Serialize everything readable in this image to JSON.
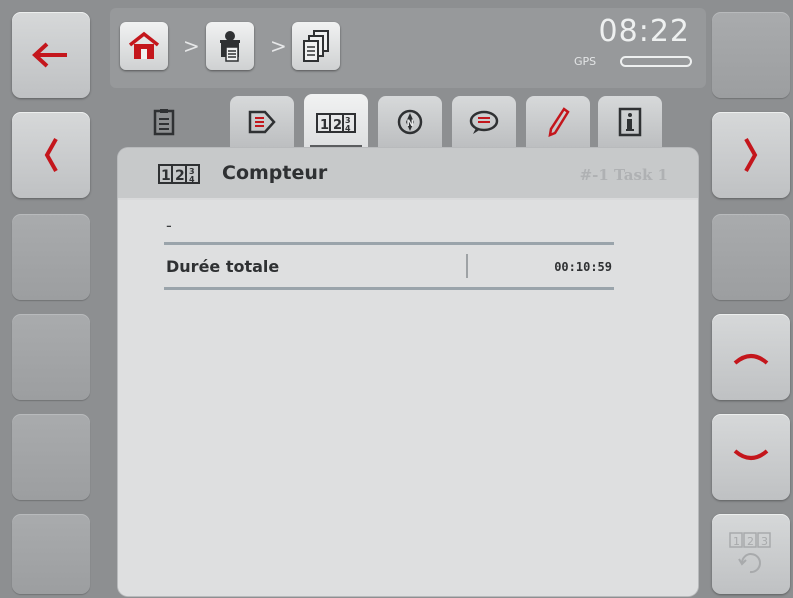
{
  "breadcrumb": {
    "separator": ">",
    "items": [
      "home-icon",
      "operator-icon",
      "task-list-icon"
    ]
  },
  "status": {
    "time": "08:22",
    "gps_label": "GPS"
  },
  "tabs": [
    {
      "icon": "document-icon",
      "active": false
    },
    {
      "icon": "export-icon",
      "active": false
    },
    {
      "icon": "counter-icon",
      "active": true
    },
    {
      "icon": "compass-icon",
      "active": false
    },
    {
      "icon": "comment-icon",
      "active": false
    },
    {
      "icon": "pencil-icon",
      "active": false
    },
    {
      "icon": "info-icon",
      "active": false
    }
  ],
  "panel": {
    "title": "Compteur",
    "task_label": "#-1 Task 1",
    "placeholder": "-",
    "rows": [
      {
        "label": "Durée totale",
        "value": "00:10:59"
      }
    ]
  },
  "softkeys": {
    "left": [
      "back-arrow-icon",
      "chevron-left-icon",
      "",
      "",
      "",
      ""
    ],
    "right": [
      "",
      "chevron-right-icon",
      "",
      "scroll-up-icon",
      "scroll-down-icon",
      "counter-reset-icon"
    ]
  }
}
